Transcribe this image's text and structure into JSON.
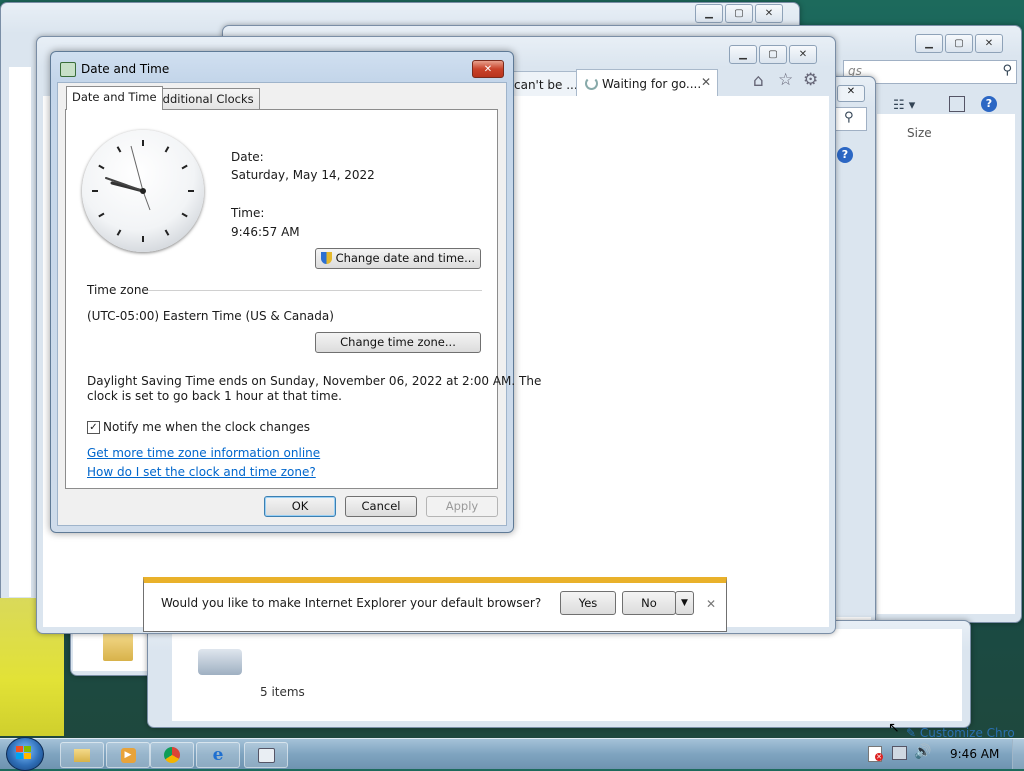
{
  "dialog": {
    "title": "Date and Time",
    "tabs": [
      "Date and Time",
      "Additional Clocks"
    ],
    "date_label": "Date:",
    "date_value": "Saturday, May 14, 2022",
    "time_label": "Time:",
    "time_value": "9:46:57 AM",
    "change_datetime_button": "Change date and time...",
    "timezone_header": "Time zone",
    "timezone_value": "(UTC-05:00) Eastern Time (US & Canada)",
    "change_timezone_button": "Change time zone...",
    "dst_line1": "Daylight Saving Time ends on Sunday, November 06, 2022 at 2:00 AM. The",
    "dst_line2": "clock is set to go back 1 hour at that time.",
    "notify_checkbox_label": "Notify me when the clock changes",
    "notify_checked": true,
    "link_more_info": "Get more time zone information online",
    "link_how_set": "How do I set the clock and time zone?",
    "ok_button": "OK",
    "cancel_button": "Cancel",
    "apply_button": "Apply"
  },
  "browser": {
    "tab_partial": "can't be ...",
    "tab_waiting": "Waiting for go....",
    "search_partial": "gs"
  },
  "explorer": {
    "column_size": "Size",
    "status_items": "5 items"
  },
  "ie_prompt": {
    "question": "Would you like to make Internet Explorer your default browser?",
    "yes_button": "Yes",
    "no_button": "No"
  },
  "desktop": {
    "customize_partial": "Customize Chro"
  },
  "taskbar": {
    "clock": "9:46 AM",
    "items": [
      "explorer-icon",
      "media-player-icon",
      "chrome-icon",
      "ie-icon",
      "date-time-icon"
    ]
  },
  "colors": {
    "accent_yellow": "#e9b12a",
    "link_blue": "#0066cc",
    "close_red": "#c9432b"
  }
}
